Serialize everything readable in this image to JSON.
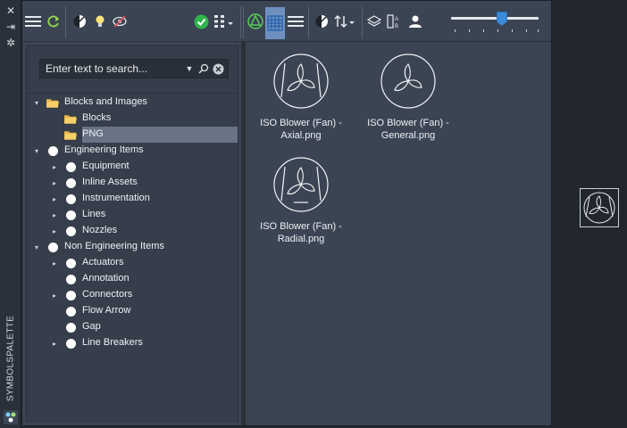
{
  "rail": {
    "title": "SYMBOLSPALETTE"
  },
  "toolbar": {
    "icons": [
      "menu-icon",
      "refresh-icon",
      "contrast-icon",
      "bulb-icon",
      "hide-eye-icon",
      "check-icon",
      "grid-dropdown-icon",
      "tree-filter-icon",
      "thumbnail-view-icon",
      "list-view-icon",
      "contrast-icon",
      "sort-icon",
      "layers-icon",
      "text-format-icon",
      "user-icon"
    ],
    "slider_value": 0.58
  },
  "search": {
    "placeholder": "Enter text to search..."
  },
  "tree": [
    {
      "label": "Blocks and Images",
      "level": 0,
      "expanded": true,
      "icon": "folder"
    },
    {
      "label": "Blocks",
      "level": 1,
      "icon": "folder"
    },
    {
      "label": "PNG",
      "level": 1,
      "icon": "folder",
      "selected": true
    },
    {
      "label": "Engineering Items",
      "level": 0,
      "expanded": true,
      "icon": "dot"
    },
    {
      "label": "Equipment",
      "level": 1,
      "collapsed": true,
      "icon": "dot"
    },
    {
      "label": "Inline Assets",
      "level": 1,
      "collapsed": true,
      "icon": "dot"
    },
    {
      "label": "Instrumentation",
      "level": 1,
      "collapsed": true,
      "icon": "dot"
    },
    {
      "label": "Lines",
      "level": 1,
      "collapsed": true,
      "icon": "dot"
    },
    {
      "label": "Nozzles",
      "level": 1,
      "collapsed": true,
      "icon": "dot"
    },
    {
      "label": "Non Engineering Items",
      "level": 0,
      "expanded": true,
      "icon": "dot"
    },
    {
      "label": "Actuators",
      "level": 1,
      "collapsed": true,
      "icon": "dot"
    },
    {
      "label": "Annotation",
      "level": 1,
      "icon": "dot"
    },
    {
      "label": "Connectors",
      "level": 1,
      "collapsed": true,
      "icon": "dot"
    },
    {
      "label": "Flow Arrow",
      "level": 1,
      "icon": "dot"
    },
    {
      "label": "Gap",
      "level": 1,
      "icon": "dot"
    },
    {
      "label": "Line Breakers",
      "level": 1,
      "collapsed": true,
      "icon": "dot"
    }
  ],
  "thumbnails": [
    {
      "line1": "ISO Blower (Fan) -",
      "line2": "Axial.png",
      "symbol": "fan-axial-icon"
    },
    {
      "line1": "ISO Blower (Fan) -",
      "line2": "General.png",
      "symbol": "fan-general-icon"
    },
    {
      "line1": "ISO Blower (Fan) -",
      "line2": "Radial.png",
      "symbol": "fan-radial-icon"
    }
  ],
  "colors": {
    "background": "#22272e",
    "panel": "#3b4453",
    "tree_bg": "#363e4b",
    "selected_row": "#687385",
    "accent_blue": "#3a8bd8",
    "check_green": "#2fb54a"
  }
}
